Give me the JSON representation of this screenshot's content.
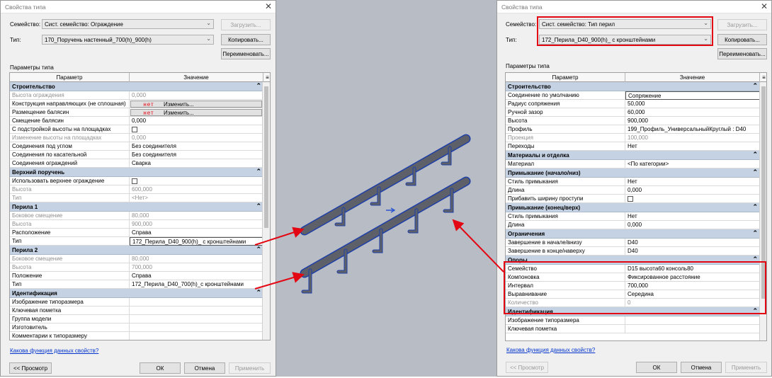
{
  "left": {
    "title": "Свойства типа",
    "family_label": "Семейство:",
    "family_value": "Сист. семейство: Ограждение",
    "load_button": "Загрузить...",
    "type_label": "Тип:",
    "type_value": "170_Поручень настенный_700(h)_900(h)",
    "copy_button": "Копировать...",
    "rename_button": "Переименовать...",
    "params_label": "Параметры типа",
    "col_param": "Параметр",
    "col_value": "Значение",
    "groups": [
      {
        "name": "Строительство",
        "rows": [
          {
            "p": "Высота ограждения",
            "v": "0,000",
            "ro": true
          },
          {
            "p": "Конструкция направляющих (не сплошная)",
            "v": "Изменить...",
            "btn": "нет"
          },
          {
            "p": "Размещение балясин",
            "v": "Изменить...",
            "btn": "нет"
          },
          {
            "p": "Смещение балясин",
            "v": "0,000"
          },
          {
            "p": "С подстройкой высоты на площадках",
            "v": "",
            "chk": true
          },
          {
            "p": "Изменение высоты на площадках",
            "v": "0,000",
            "ro": true
          },
          {
            "p": "Соединения под углом",
            "v": "Без соединителя"
          },
          {
            "p": "Соединения по касательной",
            "v": "Без соединителя"
          },
          {
            "p": "Соединения ограждений",
            "v": "Сварка"
          }
        ]
      },
      {
        "name": "Верхний поручень",
        "rows": [
          {
            "p": "Использовать верхнее ограждение",
            "v": "",
            "chk": true
          },
          {
            "p": "Высота",
            "v": "600,000",
            "ro": true
          },
          {
            "p": "Тип",
            "v": "<Нет>",
            "ro": true
          }
        ]
      },
      {
        "name": "Перила 1",
        "rows": [
          {
            "p": "Боковое смещение",
            "v": "80,000",
            "ro": true
          },
          {
            "p": "Высота",
            "v": "900,000",
            "ro": true
          },
          {
            "p": "Расположение",
            "v": "Справа"
          },
          {
            "p": "Тип",
            "v": "172_Перила_D40_900(h)_ с кронштейнами",
            "box": true
          }
        ]
      },
      {
        "name": "Перила 2",
        "rows": [
          {
            "p": "Боковое смещение",
            "v": "80,000",
            "ro": true
          },
          {
            "p": "Высота",
            "v": "700,000",
            "ro": true
          },
          {
            "p": "Положение",
            "v": "Справа"
          },
          {
            "p": "Тип",
            "v": "172_Перила_D40_700(h)_с кронштейнами"
          }
        ]
      },
      {
        "name": "Идентификация",
        "rows": [
          {
            "p": "Изображение типоразмера",
            "v": ""
          },
          {
            "p": "Ключевая пометка",
            "v": ""
          },
          {
            "p": "Группа модели",
            "v": ""
          },
          {
            "p": "Изготовитель",
            "v": ""
          },
          {
            "p": "Комментарии к типоразмеру",
            "v": ""
          }
        ]
      }
    ],
    "help_link": "Какова функция данных свойств?",
    "preview_button": "<< Просмотр",
    "ok_button": "ОК",
    "cancel_button": "Отмена",
    "apply_button": "Применить"
  },
  "right": {
    "title": "Свойства типа",
    "family_label": "Семейство:",
    "family_value": "Сист. семейство: Тип перил",
    "load_button": "Загрузить...",
    "type_label": "Тип:",
    "type_value": "172_Перила_D40_900(h)_ с кронштейнами",
    "copy_button": "Копировать...",
    "rename_button": "Переименовать...",
    "params_label": "Параметры типа",
    "col_param": "Параметр",
    "col_value": "Значение",
    "groups": [
      {
        "name": "Строительство",
        "rows": [
          {
            "p": "Соединение по умолчанию",
            "v": "Сопряжение",
            "box": true
          },
          {
            "p": "Радиус сопряжения",
            "v": "50,000"
          },
          {
            "p": "Ручной зазор",
            "v": "60,000"
          },
          {
            "p": "Высота",
            "v": "900,000"
          },
          {
            "p": "Профиль",
            "v": "199_Профиль_УниверсальныйКруглый : D40"
          },
          {
            "p": "Проекция",
            "v": "100,000",
            "ro": true
          },
          {
            "p": "Переходы",
            "v": "Нет"
          }
        ]
      },
      {
        "name": "Материалы и отделка",
        "rows": [
          {
            "p": "Материал",
            "v": "<По категории>"
          }
        ]
      },
      {
        "name": "Примыкание (начало/низ)",
        "rows": [
          {
            "p": "Стиль примыкания",
            "v": "Нет"
          },
          {
            "p": "Длина",
            "v": "0,000"
          },
          {
            "p": "Прибавить ширину проступи",
            "v": "",
            "chk": true
          }
        ]
      },
      {
        "name": "Примыкание (конец/верх)",
        "rows": [
          {
            "p": "Стиль примыкания",
            "v": "Нет"
          },
          {
            "p": "Длина",
            "v": "0,000"
          }
        ]
      },
      {
        "name": "Ограничения",
        "rows": [
          {
            "p": "Завершение в начале/внизу",
            "v": "D40"
          },
          {
            "p": "Завершение в конце/наверху",
            "v": "D40"
          }
        ]
      },
      {
        "name": "Опоры",
        "rows": [
          {
            "p": "Семейство",
            "v": "D15 высота60 консоль80"
          },
          {
            "p": "Компоновка",
            "v": "Фиксированное расстояние"
          },
          {
            "p": "Интервал",
            "v": "700,000"
          },
          {
            "p": "Выравнивание",
            "v": "Середина"
          },
          {
            "p": "Количество",
            "v": "0",
            "ro": true
          }
        ]
      },
      {
        "name": "Идентификация",
        "rows": [
          {
            "p": "Изображение типоразмера",
            "v": ""
          },
          {
            "p": "Ключевая пометка",
            "v": ""
          }
        ]
      }
    ],
    "help_link": "Какова функция данных свойств?",
    "preview_button": "<< Просмотр",
    "ok_button": "ОК",
    "cancel_button": "Отмена",
    "apply_button": "Применить"
  },
  "colors": {
    "highlight": "#e30613",
    "group_header": "#c5d2e4",
    "rail": "#5d6068",
    "rail_outline": "#1f3fa8"
  }
}
